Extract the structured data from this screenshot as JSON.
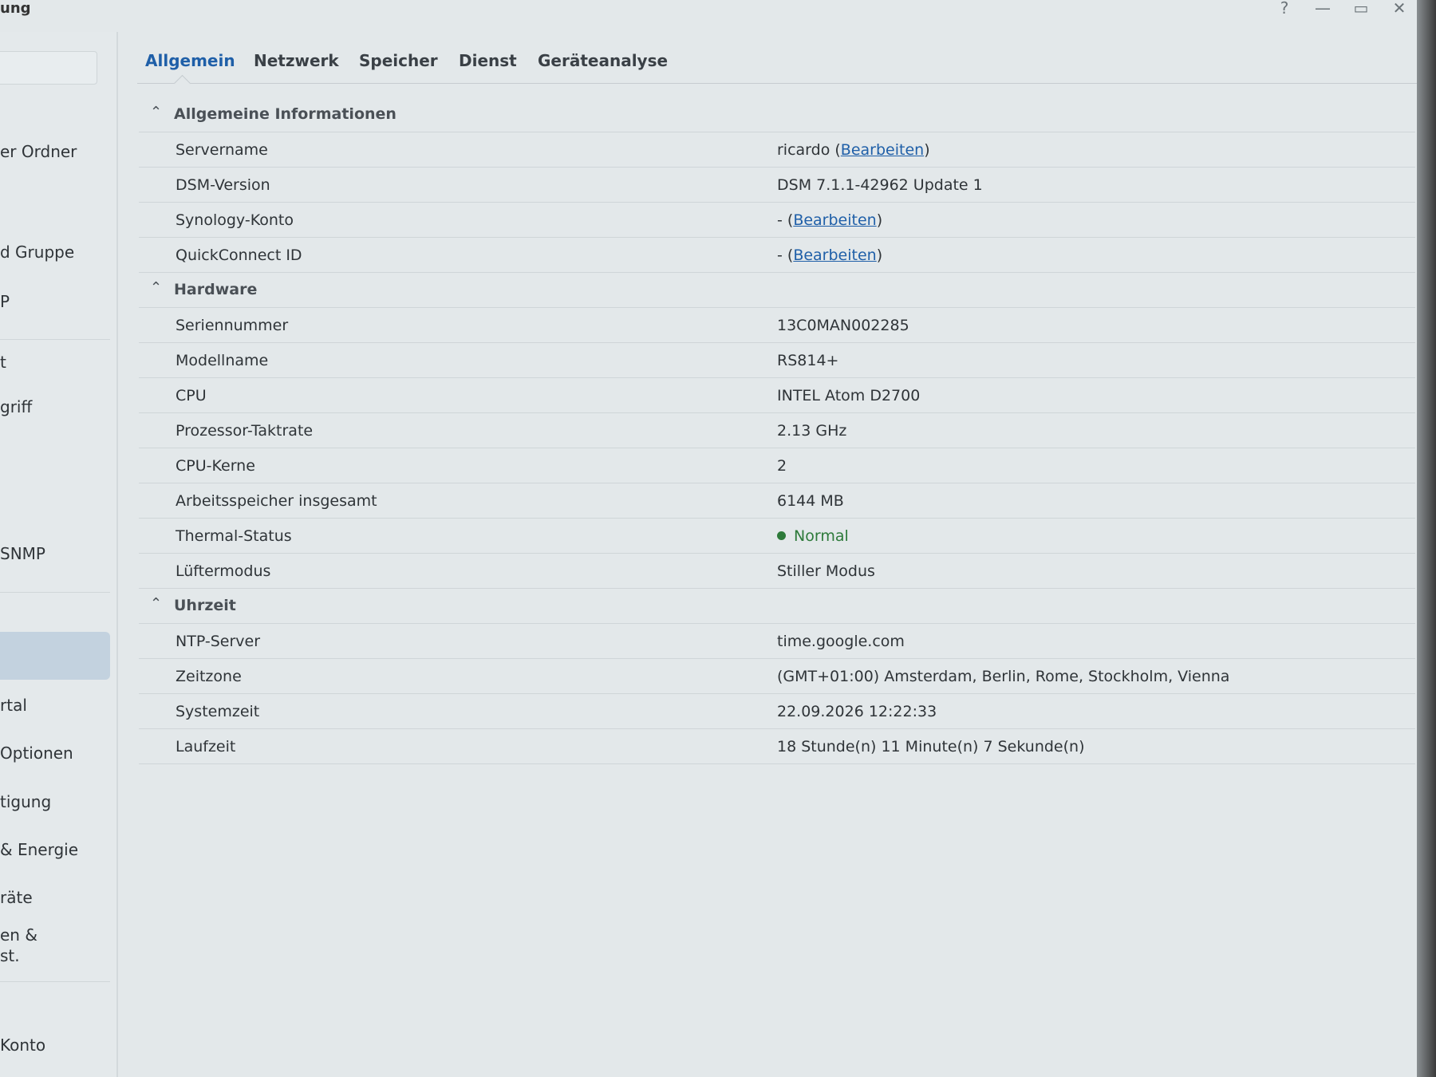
{
  "window": {
    "title": "ung",
    "controls": [
      "?",
      "—",
      "▭",
      "✕"
    ]
  },
  "sidebar": {
    "items": [
      {
        "label": "er Ordner"
      },
      {
        "label": "d Gruppe"
      },
      {
        "label": "P"
      },
      {
        "label": "t"
      },
      {
        "label": "griff"
      },
      {
        "label": "SNMP"
      },
      {
        "label": "rtal"
      },
      {
        "label": "Optionen"
      },
      {
        "label": "tigung"
      },
      {
        "label": "& Energie"
      },
      {
        "label": "räte"
      },
      {
        "label": "en &"
      },
      {
        "label": "st."
      },
      {
        "label": "Konto"
      }
    ]
  },
  "tabs": [
    {
      "label": "Allgemein",
      "active": true
    },
    {
      "label": "Netzwerk",
      "active": false
    },
    {
      "label": "Speicher",
      "active": false
    },
    {
      "label": "Dienst",
      "active": false
    },
    {
      "label": "Geräteanalyse",
      "active": false
    }
  ],
  "sections": {
    "general": {
      "title": "Allgemeine Informationen",
      "rows": {
        "servername": {
          "label": "Servername",
          "value": "ricardo",
          "link": "Bearbeiten"
        },
        "dsm": {
          "label": "DSM-Version",
          "value": "DSM 7.1.1-42962 Update 1"
        },
        "synology": {
          "label": "Synology-Konto",
          "value": "-",
          "link": "Bearbeiten"
        },
        "quickconnect": {
          "label": "QuickConnect ID",
          "value": "-",
          "link": "Bearbeiten"
        }
      }
    },
    "hardware": {
      "title": "Hardware",
      "rows": {
        "serial": {
          "label": "Seriennummer",
          "value": "13C0MAN002285"
        },
        "model": {
          "label": "Modellname",
          "value": "RS814+"
        },
        "cpu": {
          "label": "CPU",
          "value": "INTEL Atom D2700"
        },
        "clock": {
          "label": "Prozessor-Taktrate",
          "value": "2.13 GHz"
        },
        "cores": {
          "label": "CPU-Kerne",
          "value": "2"
        },
        "ram": {
          "label": "Arbeitsspeicher insgesamt",
          "value": "6144 MB"
        },
        "thermal": {
          "label": "Thermal-Status",
          "value": "Normal",
          "color": "#2d7a3a"
        },
        "fan": {
          "label": "Lüftermodus",
          "value": "Stiller Modus"
        }
      }
    },
    "time": {
      "title": "Uhrzeit",
      "rows": {
        "ntp": {
          "label": "NTP-Server",
          "value": "time.google.com"
        },
        "tz": {
          "label": "Zeitzone",
          "value": "(GMT+01:00) Amsterdam, Berlin, Rome, Stockholm, Vienna"
        },
        "systime": {
          "label": "Systemzeit",
          "value": "22.09.2026 12:22:33"
        },
        "uptime": {
          "label": "Laufzeit",
          "value": "18 Stunde(n) 11 Minute(n) 7 Sekunde(n)"
        }
      }
    }
  },
  "colors": {
    "accent": "#1f5fa8",
    "status_ok": "#2d7a3a",
    "background": "#e3e8ea"
  }
}
